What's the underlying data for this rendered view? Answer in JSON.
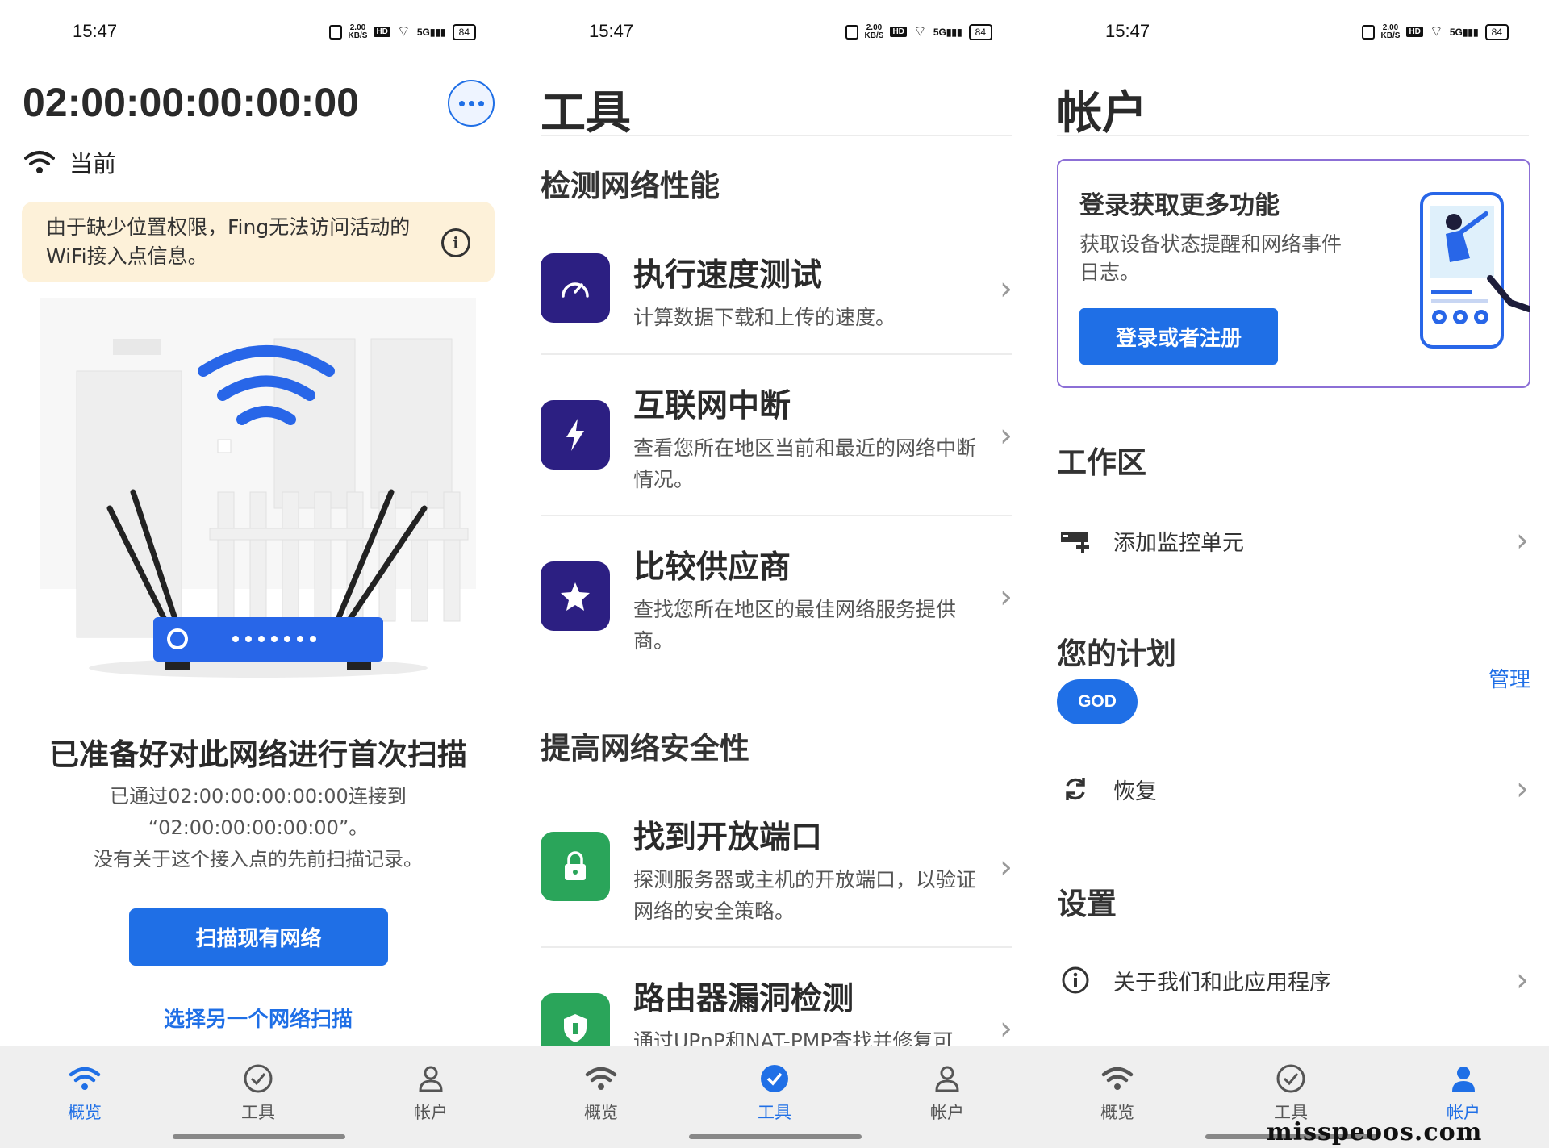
{
  "status_bar": {
    "time": "15:47",
    "speed_value": "2.00",
    "speed_unit": "KB/S",
    "hd": "HD",
    "signal": "5G",
    "battery": "84"
  },
  "nav": {
    "overview": "概览",
    "tools": "工具",
    "account": "帐户"
  },
  "overview": {
    "network_name": "02:00:00:00:00:00",
    "current_label": "当前",
    "warning": "由于缺少位置权限，Fing无法访问活动的WiFi接入点信息。",
    "ready_title": "已准备好对此网络进行首次扫描",
    "desc_line1": "已通过02:00:00:00:00:00连接到",
    "desc_line2": "“02:00:00:00:00:00”。",
    "desc_line3": "没有关于这个接入点的先前扫描记录。",
    "scan_button": "扫描现有网络",
    "choose_link": "选择另一个网络扫描"
  },
  "tools": {
    "title": "工具",
    "section1": "检测网络性能",
    "section2": "提高网络安全性",
    "items": [
      {
        "name": "执行速度测试",
        "desc": "计算数据下载和上传的速度。"
      },
      {
        "name": "互联网中断",
        "desc": "查看您所在地区当前和最近的网络中断情况。"
      },
      {
        "name": "比较供应商",
        "desc": "查找您所在地区的最佳网络服务提供商。"
      },
      {
        "name": "找到开放端口",
        "desc": "探测服务器或主机的开放端口，以验证网络的安全策略。"
      },
      {
        "name": "路由器漏洞检测",
        "desc": "通过UPnP和NAT-PMP查找并修复可"
      }
    ]
  },
  "account": {
    "title": "帐户",
    "login_title": "登录获取更多功能",
    "login_desc": "获取设备状态提醒和网络事件日志。",
    "login_button": "登录或者注册",
    "workspace_heading": "工作区",
    "add_monitor": "添加监控单元",
    "plan_heading": "您的计划",
    "manage": "管理",
    "plan_badge": "GOD",
    "restore": "恢复",
    "settings_heading": "设置",
    "about": "关于我们和此应用程序"
  },
  "watermark": "misspeoos.com",
  "colors": {
    "accent": "#1f6fe6",
    "tool_purple": "#2c1f82",
    "tool_green": "#2aa55a",
    "warning_bg": "#fdf1d9",
    "card_border": "#8c6fd6"
  }
}
